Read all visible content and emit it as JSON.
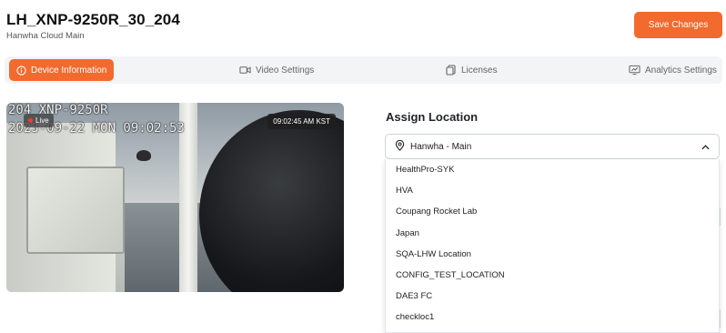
{
  "header": {
    "title": "LH_XNP-9250R_30_204",
    "subtitle": "Hanwha Cloud Main",
    "save_label": "Save Changes"
  },
  "tabs": [
    {
      "label": "Device Information",
      "icon": "info-icon",
      "active": true
    },
    {
      "label": "Video Settings",
      "icon": "video-icon",
      "active": false
    },
    {
      "label": "Licenses",
      "icon": "license-icon",
      "active": false
    },
    {
      "label": "Analytics Settings",
      "icon": "analytics-icon",
      "active": false
    }
  ],
  "video": {
    "osd_line1": "204_XNP-9250R",
    "osd_line2": "2023-09-22 MON 09:02:53",
    "live_label": "Live",
    "timestamp": "09:02:45 AM KST"
  },
  "location": {
    "title": "Assign Location",
    "selected": "Hanwha - Main",
    "options": [
      "HealthPro-SYK",
      "HVA",
      "Coupang Rocket Lab",
      "Japan",
      "SQA-LHW Location",
      "CONFIG_TEST_LOCATION",
      "DAE3 FC",
      "checkloc1"
    ]
  },
  "colors": {
    "accent": "#f26a2e",
    "tab_bar": "#f3f4f6"
  }
}
